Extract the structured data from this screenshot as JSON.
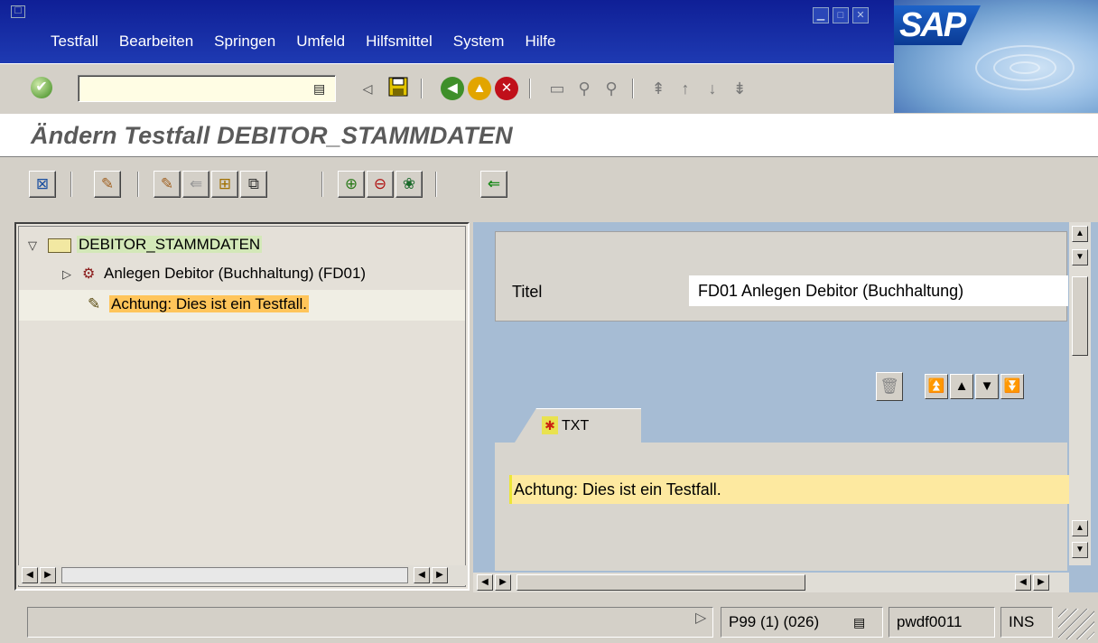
{
  "menu": {
    "items": [
      "Testfall",
      "Bearbeiten",
      "Springen",
      "Umfeld",
      "Hilfsmittel",
      "System",
      "Hilfe"
    ]
  },
  "logo": {
    "text": "SAP"
  },
  "command_field": {
    "value": ""
  },
  "title": "Ändern Testfall DEBITOR_STAMMDATEN",
  "tree": {
    "root_label": "DEBITOR_STAMMDATEN",
    "node1_label": "Anlegen Debitor (Buchhaltung) (FD01)",
    "node2_label": "Achtung: Dies ist ein Testfall."
  },
  "detail": {
    "titel_label": "Titel",
    "titel_value": "FD01 Anlegen Debitor (Buchhaltung)",
    "tab_label": "TXT",
    "note_text": "Achtung: Dies ist ein Testfall."
  },
  "status": {
    "system": "P99 (1) (026)",
    "server": "pwdf0011",
    "mode": "INS"
  },
  "colors": {
    "menubar": "#1e3ab2",
    "tree_root_highlight": "#d3e8b8",
    "tree_selected_highlight": "#ffc55a",
    "note_background": "#fde9a0",
    "right_panel": "#a6bcd4"
  }
}
